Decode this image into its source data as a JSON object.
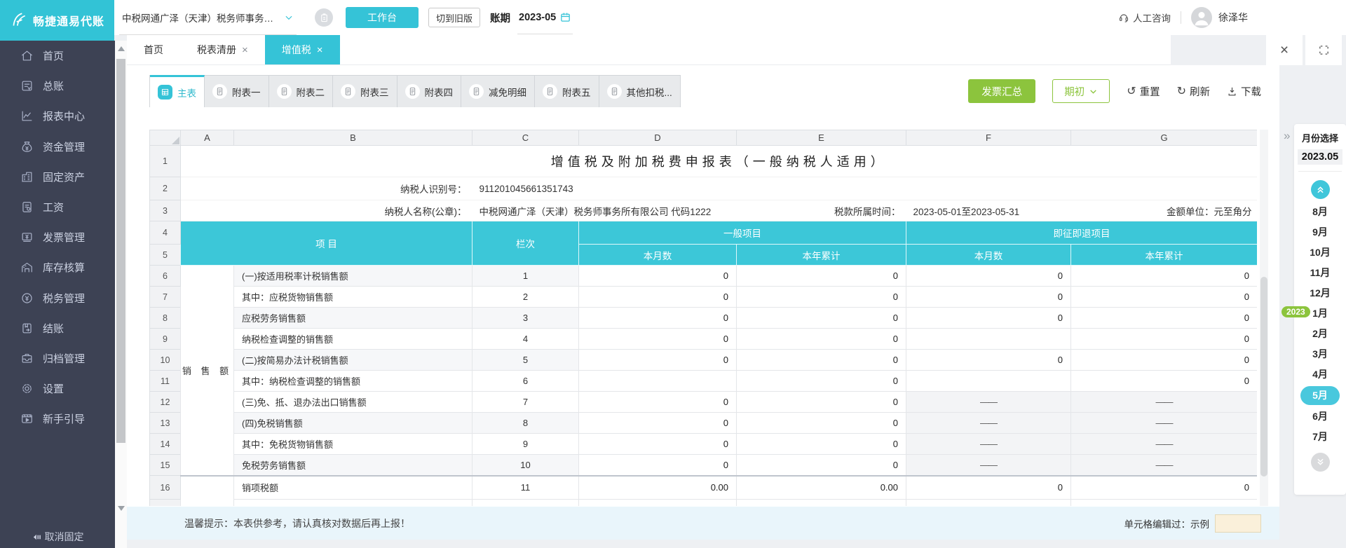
{
  "app": {
    "logo_text": "畅捷通易代账",
    "company_selector": "中税网通广泽（天津）税务师事务所有...",
    "workbench_button": "工作台",
    "switch_old_button": "切到旧版",
    "period_label": "账期",
    "period_value": "2023-05",
    "support_label": "人工咨询",
    "user_name": "徐泽华"
  },
  "colors": {
    "teal": "#35c3d7",
    "green": "#8cc43d",
    "sidebar": "#3d4254",
    "edited_swatch": "#faf0da"
  },
  "sidebar": {
    "items": [
      {
        "id": "home",
        "icon": "home-icon",
        "label": "首页"
      },
      {
        "id": "ledger",
        "icon": "ledger-icon",
        "label": "总账"
      },
      {
        "id": "reports",
        "icon": "report-chart-icon",
        "label": "报表中心"
      },
      {
        "id": "funds",
        "icon": "money-bag-icon",
        "label": "资金管理"
      },
      {
        "id": "assets",
        "icon": "building-icon",
        "label": "固定资产"
      },
      {
        "id": "salary",
        "icon": "salary-doc-icon",
        "label": "工资"
      },
      {
        "id": "invoice",
        "icon": "invoice-icon",
        "label": "发票管理"
      },
      {
        "id": "inventory",
        "icon": "warehouse-icon",
        "label": "库存核算"
      },
      {
        "id": "tax",
        "icon": "tax-coin-icon",
        "label": "税务管理"
      },
      {
        "id": "closing",
        "icon": "closing-book-icon",
        "label": "结账"
      },
      {
        "id": "archive",
        "icon": "archive-box-icon",
        "label": "归档管理"
      },
      {
        "id": "settings",
        "icon": "gear-icon",
        "label": "设置"
      },
      {
        "id": "guide",
        "icon": "guide-video-icon",
        "label": "新手引导"
      }
    ],
    "unpin_label": "取消固定"
  },
  "tabs": [
    {
      "id": "home",
      "label": "首页",
      "closable": false,
      "active": false
    },
    {
      "id": "tax-list",
      "label": "税表清册",
      "closable": true,
      "active": false
    },
    {
      "id": "vat",
      "label": "增值税",
      "closable": true,
      "active": true
    }
  ],
  "sheet_tabs": [
    {
      "label": "主表",
      "active": true
    },
    {
      "label": "附表一",
      "active": false
    },
    {
      "label": "附表二",
      "active": false
    },
    {
      "label": "附表三",
      "active": false
    },
    {
      "label": "附表四",
      "active": false
    },
    {
      "label": "减免明细",
      "active": false
    },
    {
      "label": "附表五",
      "active": false
    },
    {
      "label": "其他扣税...",
      "active": false
    }
  ],
  "toolbar": {
    "invoice_summary": "发票汇总",
    "period_init": "期初",
    "reset": "重置",
    "refresh": "刷新",
    "download": "下载"
  },
  "spreadsheet": {
    "column_headers": [
      "A",
      "B",
      "C",
      "D",
      "E",
      "F",
      "G"
    ],
    "title": "增值税及附加税费申报表（一般纳税人适用）",
    "taxpayer_id_label": "纳税人识别号：",
    "taxpayer_id": "911201045661351743",
    "taxpayer_name_label": "纳税人名称(公章)：",
    "taxpayer_name": "中税网通广泽（天津）税务师事务所有限公司 代码1222",
    "tax_period_label": "税款所属时间：",
    "tax_period": "2023-05-01至2023-05-31",
    "unit_label": "金额单位：元至角分",
    "header": {
      "item": "项 目",
      "column_no": "栏次",
      "general": "一般项目",
      "instant_refund": "即征即退项目",
      "month": "本月数",
      "year_total": "本年累计"
    },
    "group_label": "销 售 额",
    "rows": [
      {
        "row": 6,
        "item": "(一)按适用税率计税销售额",
        "no": "1",
        "values": [
          "0",
          "0",
          "0",
          "0"
        ]
      },
      {
        "row": 7,
        "item": "其中：应税货物销售额",
        "no": "2",
        "values": [
          "0",
          "0",
          "0",
          "0"
        ]
      },
      {
        "row": 8,
        "item": "应税劳务销售额",
        "no": "3",
        "values": [
          "0",
          "0",
          "0",
          "0"
        ]
      },
      {
        "row": 9,
        "item": "纳税检查调整的销售额",
        "no": "4",
        "values": [
          "0",
          "0",
          "",
          "0"
        ]
      },
      {
        "row": 10,
        "item": "(二)按简易办法计税销售额",
        "no": "5",
        "values": [
          "0",
          "0",
          "0",
          "0"
        ]
      },
      {
        "row": 11,
        "item": "其中：纳税检查调整的销售额",
        "no": "6",
        "values": [
          "",
          "0",
          "",
          "0"
        ]
      },
      {
        "row": 12,
        "item": "(三)免、抵、退办法出口销售额",
        "no": "7",
        "values": [
          "0",
          "0",
          "——",
          "——"
        ]
      },
      {
        "row": 13,
        "item": "(四)免税销售额",
        "no": "8",
        "values": [
          "0",
          "0",
          "——",
          "——"
        ]
      },
      {
        "row": 14,
        "item": "其中：免税货物销售额",
        "no": "9",
        "values": [
          "0",
          "0",
          "——",
          "——"
        ]
      },
      {
        "row": 15,
        "item": "免税劳务销售额",
        "no": "10",
        "values": [
          "0",
          "0",
          "——",
          "——"
        ]
      },
      {
        "row": 16,
        "item": "销项税额",
        "no": "11",
        "values": [
          "0.00",
          "0.00",
          "0",
          "0"
        ]
      }
    ]
  },
  "footer": {
    "tip": "温馨提示：本表供参考，请认真核对数据后再上报！",
    "edited_label": "单元格编辑过：示例"
  },
  "month_panel": {
    "title": "月份选择",
    "current": "2023.05",
    "year_badge": "2023",
    "months": [
      "8月",
      "9月",
      "10月",
      "11月",
      "12月",
      "1月",
      "2月",
      "3月",
      "4月",
      "5月",
      "6月",
      "7月"
    ],
    "selected": "5月"
  }
}
